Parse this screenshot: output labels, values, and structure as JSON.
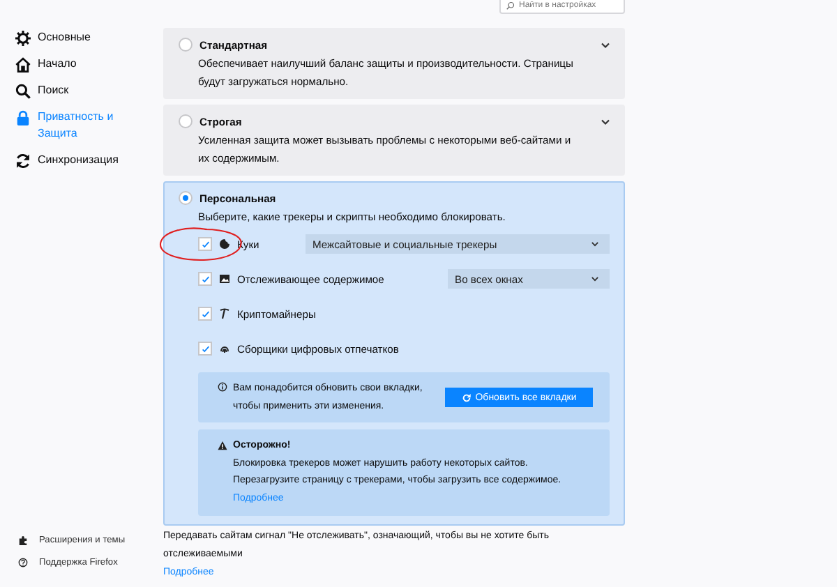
{
  "search": {
    "placeholder": "Найти в настройках"
  },
  "sidebar": {
    "items": [
      {
        "label": "Основные",
        "selected": false
      },
      {
        "label": "Начало",
        "selected": false
      },
      {
        "label": "Поиск",
        "selected": false
      },
      {
        "label": "Приватность и Защита",
        "selected": true
      },
      {
        "label": "Синхронизация",
        "selected": false
      }
    ],
    "footer": [
      {
        "label": "Расширения и темы"
      },
      {
        "label": "Поддержка Firefox"
      }
    ]
  },
  "protection_levels": [
    {
      "title": "Стандартная",
      "selected": false,
      "expanded": false,
      "description": "Обеспечивает наилучший баланс защиты и производительности. Страницы будут загружаться нормально."
    },
    {
      "title": "Строгая",
      "selected": false,
      "expanded": false,
      "description": "Усиленная защита может вызывать проблемы с некоторыми веб-сайтами и их содержимым."
    },
    {
      "title": "Персональная",
      "selected": true,
      "expanded": true,
      "description": "Выберите, какие трекеры и скрипты необходимо блокировать."
    }
  ],
  "custom_options": [
    {
      "label": "Куки",
      "checked": true,
      "dropdown": "Межсайтовые и социальные трекеры"
    },
    {
      "label": "Отслеживающее содержимое",
      "checked": true,
      "dropdown": "Во всех окнах"
    },
    {
      "label": "Криптомайнеры",
      "checked": true
    },
    {
      "label": "Сборщики цифровых отпечатков",
      "checked": true
    }
  ],
  "reload_notice": {
    "text": "Вам понадобится обновить свои вкладки, чтобы применить эти изменения.",
    "button": "Обновить все вкладки"
  },
  "warning": {
    "title": "Осторожно!",
    "lines": [
      "Блокировка трекеров может нарушить работу некоторых сайтов.",
      "Перезагрузите страницу с трекерами, чтобы загрузить все содержимое."
    ],
    "link": "Подробнее"
  },
  "do_not_track": {
    "text": "Передавать сайтам сигнал \"Не отслеживать\", означающий, чтобы вы не хотите быть отслеживаемыми",
    "link": "Подробнее"
  },
  "annotations": [
    {
      "kind": "ellipse"
    }
  ]
}
